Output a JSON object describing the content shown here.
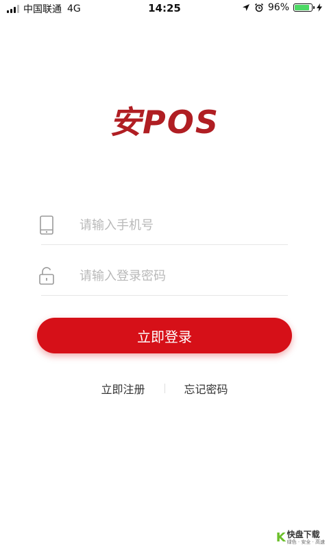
{
  "status_bar": {
    "carrier": "中国联通",
    "network": "4G",
    "time": "14:25",
    "battery_percent_text": "96%",
    "battery_level": 0.96
  },
  "logo": {
    "text": "安POS",
    "color": "#b01e23"
  },
  "form": {
    "phone_placeholder": "请输入手机号",
    "phone_value": "",
    "password_placeholder": "请输入登录密码",
    "password_value": ""
  },
  "login_button": {
    "label": "立即登录",
    "color": "#d61018"
  },
  "links": {
    "register": "立即注册",
    "forgot_password": "忘记密码"
  },
  "watermark": {
    "brand": "快盘下载",
    "tagline": "绿色 · 安全 · 高速"
  }
}
